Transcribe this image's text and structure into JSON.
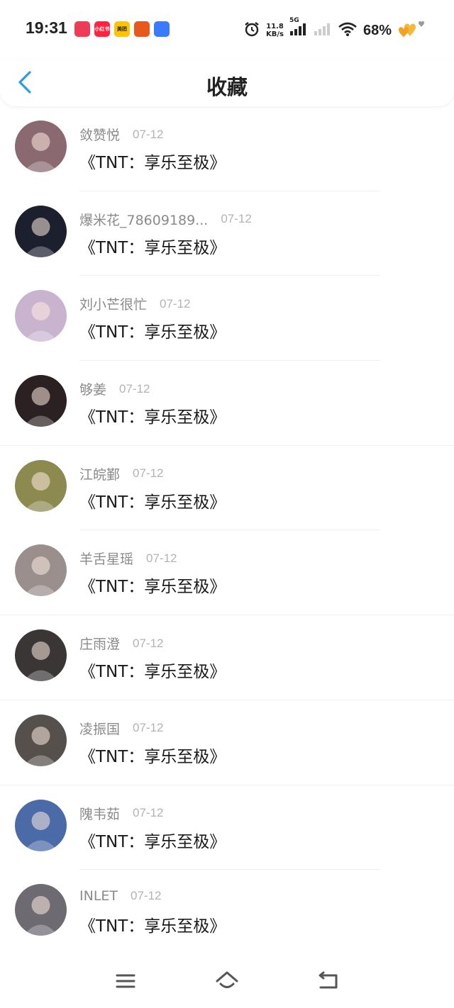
{
  "status_bar": {
    "time": "19:31",
    "net_speed_value": "11.8",
    "net_speed_unit": "KB/s",
    "network": "5G",
    "battery": "68%",
    "notifications": [
      {
        "name": "douyin-icon",
        "color": "#ef3b57",
        "label": ""
      },
      {
        "name": "xiaohongshu-icon",
        "color": "#ff2442",
        "label": "小红书"
      },
      {
        "name": "meituan-icon",
        "color": "#ffc300",
        "label": "美团"
      },
      {
        "name": "pumpkin-icon",
        "color": "#e8581c",
        "label": ""
      },
      {
        "name": "browser-icon",
        "color": "#3a7bfd",
        "label": ""
      }
    ]
  },
  "header": {
    "title": "收藏",
    "accent": "#2a9ee4"
  },
  "items": [
    {
      "user": "敛赞悦",
      "date": "07-12",
      "title": "《TNT：享乐至极》",
      "avatar_bg": "#8a6a70"
    },
    {
      "user": "爆米花_78609189...",
      "date": "07-12",
      "title": "《TNT：享乐至极》",
      "avatar_bg": "#1c1f2e"
    },
    {
      "user": "刘小芒很忙",
      "date": "07-12",
      "title": "《TNT：享乐至极》",
      "avatar_bg": "#c9b4cf"
    },
    {
      "user": "够姜",
      "date": "07-12",
      "title": "《TNT：享乐至极》",
      "avatar_bg": "#2b2022"
    },
    {
      "user": "江皖鄞",
      "date": "07-12",
      "title": "《TNT：享乐至极》",
      "avatar_bg": "#8d8a4f"
    },
    {
      "user": "羊舌星瑶",
      "date": "07-12",
      "title": "《TNT：享乐至极》",
      "avatar_bg": "#9a8f8d"
    },
    {
      "user": "庄雨澄",
      "date": "07-12",
      "title": "《TNT：享乐至极》",
      "avatar_bg": "#3a3636"
    },
    {
      "user": "凌振国",
      "date": "07-12",
      "title": "《TNT：享乐至极》",
      "avatar_bg": "#56504c"
    },
    {
      "user": "隗韦茹",
      "date": "07-12",
      "title": "《TNT：享乐至极》",
      "avatar_bg": "#4a6aa8"
    },
    {
      "user": "INLET",
      "date": "07-12",
      "title": "《TNT：享乐至极》",
      "avatar_bg": "#6d6a72"
    }
  ],
  "bottom_nav": {
    "menu_icon": "menu-icon",
    "home_icon": "home-icon",
    "back_icon": "return-icon"
  }
}
